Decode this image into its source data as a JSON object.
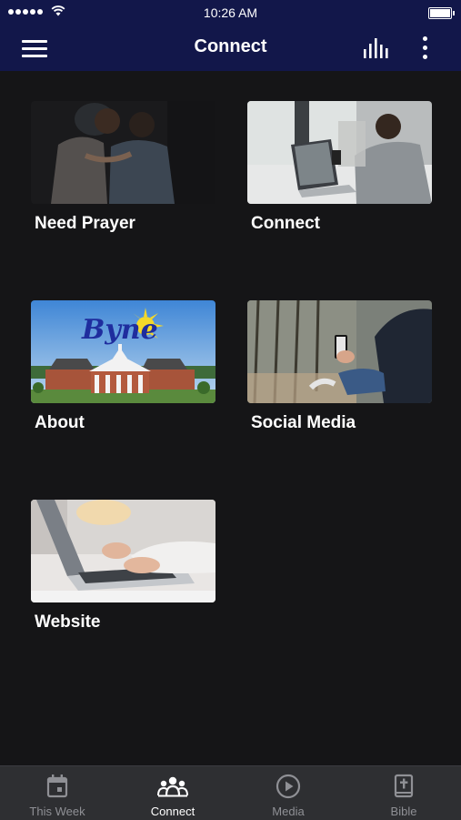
{
  "status_bar": {
    "time": "10:26 AM"
  },
  "nav": {
    "title": "Connect",
    "menu_icon": "hamburger-menu-icon",
    "chart_icon": "bar-chart-icon",
    "more_icon": "more-vertical-icon"
  },
  "tiles": [
    {
      "label": "Need Prayer",
      "image": "two men praying"
    },
    {
      "label": "Connect",
      "image": "man using laptop"
    },
    {
      "label": "About",
      "image": "church building with Byne logo",
      "logo_text": "Byne"
    },
    {
      "label": "Social Media",
      "image": "person holding phone"
    },
    {
      "label": "Website",
      "image": "hands typing on laptop"
    }
  ],
  "tabs": [
    {
      "label": "This Week",
      "icon": "calendar-icon",
      "active": false
    },
    {
      "label": "Connect",
      "icon": "people-group-icon",
      "active": true
    },
    {
      "label": "Media",
      "icon": "play-circle-icon",
      "active": false
    },
    {
      "label": "Bible",
      "icon": "bible-icon",
      "active": false
    }
  ],
  "colors": {
    "header_bg": "#12174a",
    "page_bg": "#151517",
    "tabbar_bg": "#2e2f32",
    "tab_inactive": "#8f9095",
    "tab_active": "#ffffff"
  }
}
